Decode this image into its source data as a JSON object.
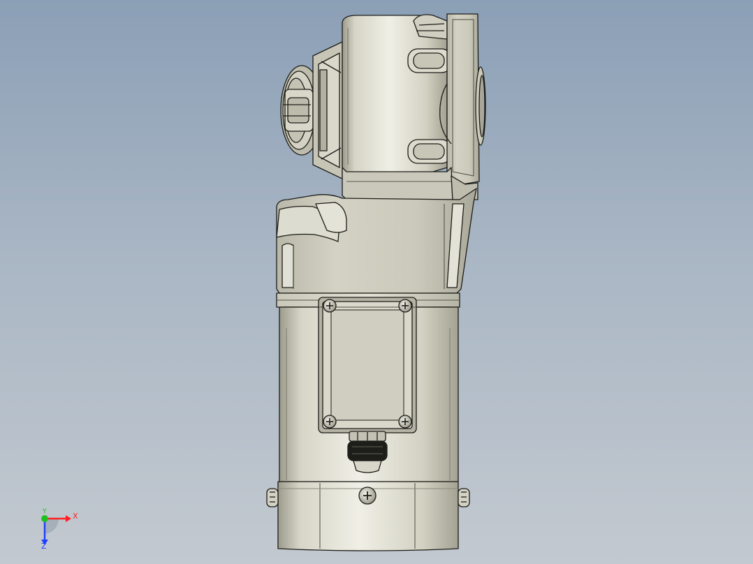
{
  "viewport": {
    "background_top": "#8b9fb6",
    "background_bottom": "#c3c9d0",
    "model_name": "gear-motor-assembly",
    "body_color": "#cfcebf",
    "edge_color": "#1c1c18",
    "shadow_color": "#8f8e80",
    "highlight_color": "#f1f1e8"
  },
  "triad": {
    "x_label": "X",
    "y_label": "Y",
    "z_label": "Z",
    "x_color": "#ff2020",
    "y_color": "#20c020",
    "z_color": "#2040ff"
  }
}
